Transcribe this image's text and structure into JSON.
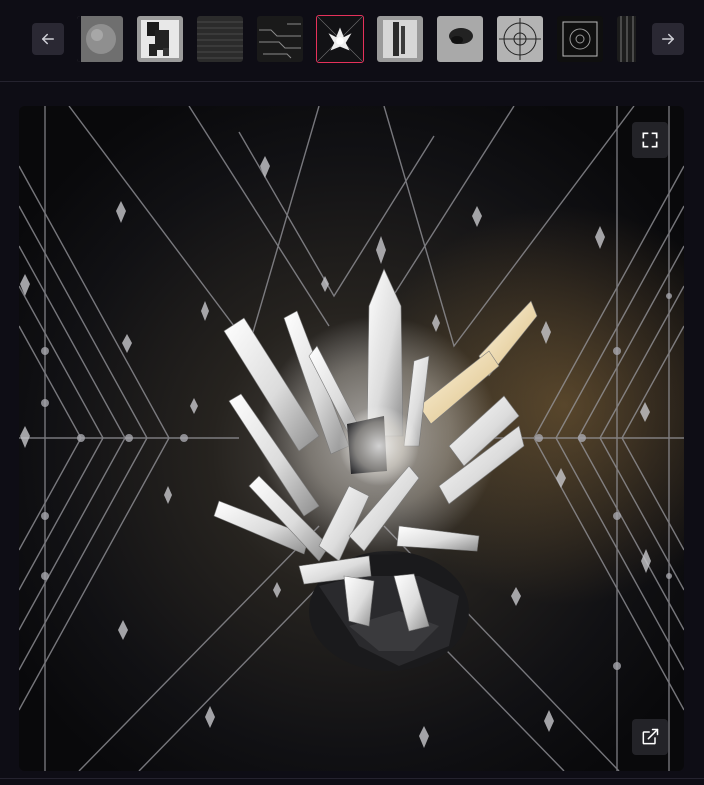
{
  "toolbar": {
    "prev_icon": "arrow-left-icon",
    "next_icon": "arrow-right-icon"
  },
  "thumbnails": [
    {
      "name": "thumb-1",
      "active": false,
      "tone": "#8a8a8a"
    },
    {
      "name": "thumb-2",
      "active": false,
      "tone": "#9a9a9a"
    },
    {
      "name": "thumb-3",
      "active": false,
      "tone": "#2e2e2e"
    },
    {
      "name": "thumb-4",
      "active": false,
      "tone": "#1e1e1e"
    },
    {
      "name": "thumb-5",
      "active": true,
      "tone": "#111111"
    },
    {
      "name": "thumb-6",
      "active": false,
      "tone": "#9b9b9b"
    },
    {
      "name": "thumb-7",
      "active": false,
      "tone": "#a2a2a2"
    },
    {
      "name": "thumb-8",
      "active": false,
      "tone": "#a8a8a8"
    },
    {
      "name": "thumb-9",
      "active": false,
      "tone": "#0f0f0f"
    },
    {
      "name": "thumb-10",
      "active": false,
      "tone": "#2a2a2a"
    }
  ],
  "viewer": {
    "fullscreen_icon": "expand-icon",
    "external_icon": "external-link-icon"
  },
  "colors": {
    "accent": "#e5315b",
    "background": "#0e0d15",
    "button": "#2a2833"
  }
}
